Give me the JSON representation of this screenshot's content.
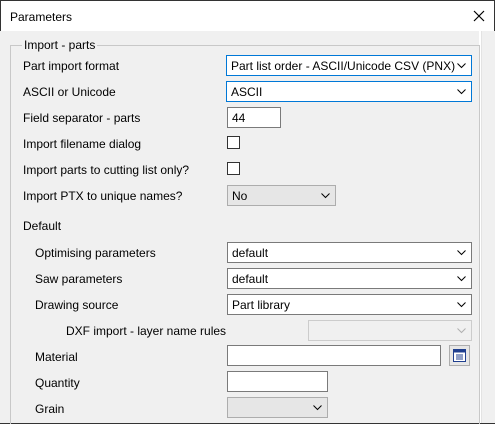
{
  "window": {
    "title": "Parameters"
  },
  "import_parts": {
    "group_label": "Import - parts",
    "part_import_format": {
      "label": "Part import format",
      "value": "Part list order - ASCII/Unicode CSV (PNX)"
    },
    "ascii_or_unicode": {
      "label": "ASCII or Unicode",
      "value": "ASCII"
    },
    "field_separator": {
      "label": "Field separator - parts",
      "value": "44"
    },
    "import_filename_dialog": {
      "label": "Import filename dialog",
      "checked": false
    },
    "import_to_cutting_list": {
      "label": "Import parts to cutting list only?",
      "checked": false
    },
    "import_ptx_unique": {
      "label": "Import PTX to unique names?",
      "value": "No"
    }
  },
  "default": {
    "section_label": "Default",
    "optimising_parameters": {
      "label": "Optimising parameters",
      "value": "default"
    },
    "saw_parameters": {
      "label": "Saw parameters",
      "value": "default"
    },
    "drawing_source": {
      "label": "Drawing source",
      "value": "Part library"
    },
    "dxf_import_rules": {
      "label": "DXF import - layer name rules",
      "value": ""
    },
    "material": {
      "label": "Material",
      "value": ""
    },
    "quantity": {
      "label": "Quantity",
      "value": ""
    },
    "grain": {
      "label": "Grain",
      "value": ""
    }
  },
  "icons": {
    "close": "close-icon",
    "dropdown": "chevron-down-icon",
    "browse": "list-browse-icon"
  },
  "colors": {
    "focus_border": "#0078d7",
    "dialog_background": "#f0f0f0"
  }
}
